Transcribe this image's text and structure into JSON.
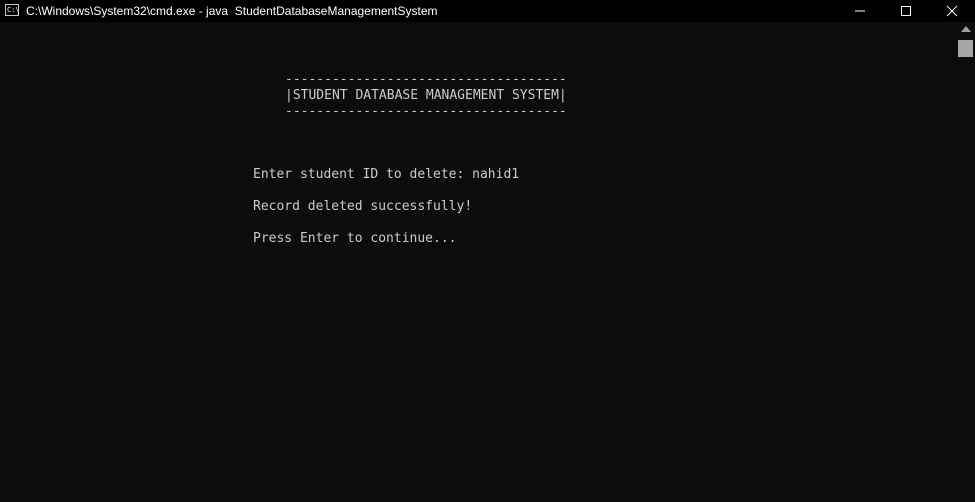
{
  "window": {
    "title": "C:\\Windows\\System32\\cmd.exe - java  StudentDatabaseManagementSystem",
    "icon_text": "C:\\"
  },
  "console": {
    "banner_top": "------------------------------------",
    "banner_title": "|STUDENT DATABASE MANAGEMENT SYSTEM|",
    "banner_bottom": "------------------------------------",
    "prompt_line": "Enter student ID to delete: nahid1",
    "result_line": "Record deleted successfully!",
    "continue_line": "Press Enter to continue..."
  },
  "colors": {
    "console_bg": "#0c0c0c",
    "console_fg": "#cccccc",
    "titlebar_bg": "#000000",
    "scroll_thumb": "#a6a6a6"
  }
}
